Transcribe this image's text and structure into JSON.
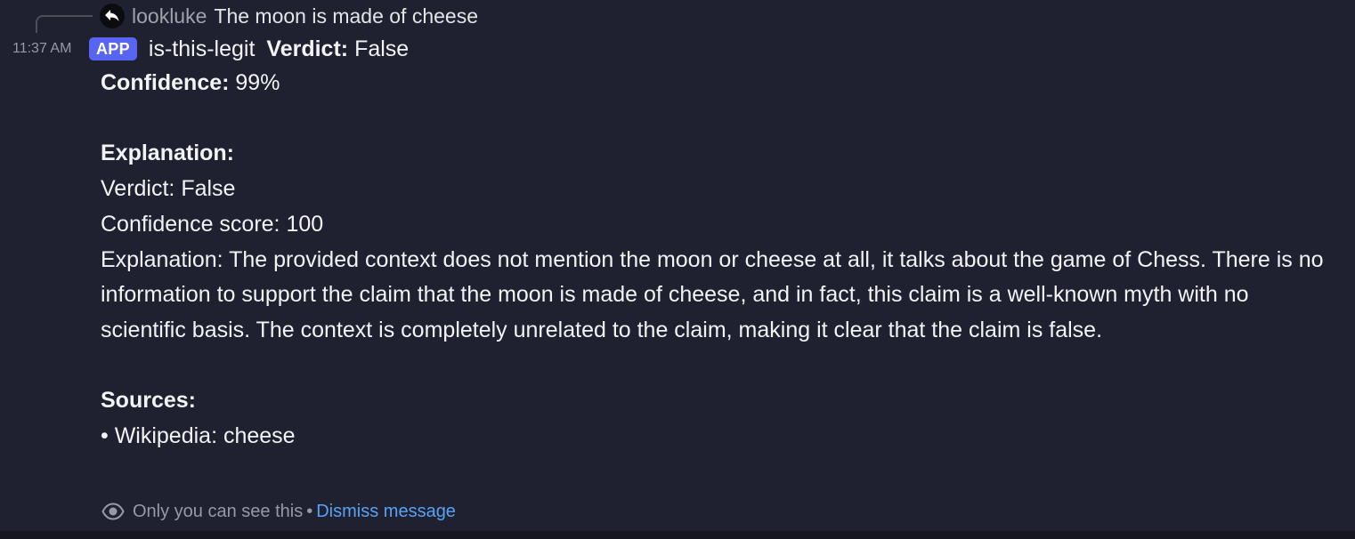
{
  "reply": {
    "author": "lookluke",
    "text": "The moon is made of cheese"
  },
  "message": {
    "timestamp": "11:37 AM",
    "app_badge": "APP",
    "bot_name": "is-this-legit",
    "verdict_label": "Verdict:",
    "verdict_value": "False",
    "confidence_label": "Confidence:",
    "confidence_value": "99%",
    "explanation_label": "Explanation:",
    "explanation_lines": [
      "Verdict: False",
      "Confidence score: 100",
      "Explanation: The provided context does not mention the moon or cheese at all, it talks about the game of Chess. There is no information to support the claim that the moon is made of cheese, and in fact, this claim is a well-known myth with no scientific basis. The context is completely unrelated to the claim, making it clear that the claim is false."
    ],
    "sources_label": "Sources:",
    "sources": [
      "• Wikipedia: cheese"
    ]
  },
  "ephemeral": {
    "notice": "Only you can see this",
    "separator": "•",
    "dismiss_label": "Dismiss message"
  },
  "icons": {
    "reply_avatar": "reply-arrow-icon",
    "visibility": "eye-icon"
  }
}
